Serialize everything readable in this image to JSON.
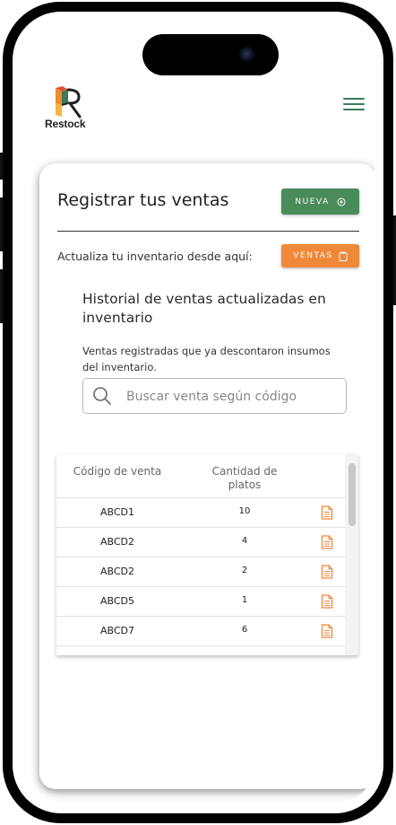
{
  "app": {
    "name": "Restock"
  },
  "card": {
    "title": "Registrar tus ventas",
    "new_button_label": "NUEVA",
    "update_text": "Actualiza tu inventario desde aquí:",
    "sales_button_label": "VENTAS"
  },
  "history": {
    "title": "Historial de ventas actualizadas en inventario",
    "description": "Ventas registradas que ya descontaron insumos del inventario.",
    "search_placeholder": "Buscar venta según código"
  },
  "table": {
    "headers": [
      "Código de venta",
      "Cantidad de platos"
    ],
    "rows": [
      {
        "code": "ABCD1",
        "qty": "10"
      },
      {
        "code": "ABCD2",
        "qty": "4"
      },
      {
        "code": "ABCD2",
        "qty": "2"
      },
      {
        "code": "ABCD5",
        "qty": "1"
      },
      {
        "code": "ABCD7",
        "qty": "6"
      }
    ]
  },
  "colors": {
    "primary_green": "#4a8b5c",
    "accent_orange": "#f0883a",
    "menu_green": "#3d7a55"
  },
  "icons": {
    "menu": "hamburger-menu-icon",
    "new": "plus-circle-icon",
    "sales": "clipboard-icon",
    "search": "search-icon",
    "row_action": "document-icon"
  }
}
